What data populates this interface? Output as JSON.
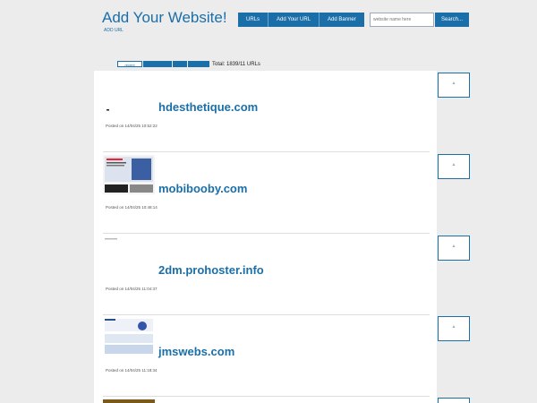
{
  "header": {
    "title": "Add Your Website!",
    "subtitle": "ADD URL"
  },
  "nav": {
    "urls_label": "URLs",
    "add_url_label": "Add Your URL",
    "add_banner_label": "Add Banner"
  },
  "search": {
    "placeholder": "website name here",
    "button_label": "Search..."
  },
  "tabs": {
    "tab0_label": "recent",
    "total": "Total: 1839/11 URLs"
  },
  "entries": [
    {
      "domain": "hdesthetique.com",
      "posted": "Posted on 14/04/25 10:52:22"
    },
    {
      "domain": "mobibooby.com",
      "posted": "Posted on 14/04/25 10:48:14"
    },
    {
      "domain": "2dm.prohoster.info",
      "posted": "Posted on 14/04/25 11:04:37"
    },
    {
      "domain": "jmswebs.com",
      "posted": "Posted on 14/04/25 11:18:34"
    }
  ],
  "colors": {
    "accent": "#1a6fa8",
    "background": "#ececec"
  }
}
